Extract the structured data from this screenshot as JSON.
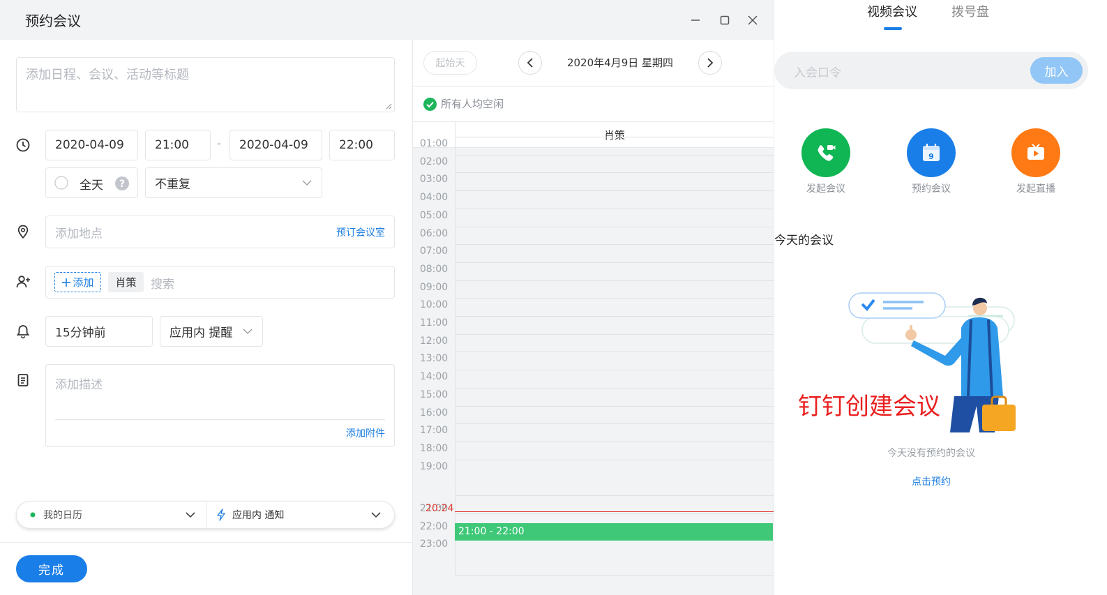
{
  "window": {
    "title": "预约会议"
  },
  "form": {
    "title_placeholder": "添加日程、会议、活动等标题",
    "start_date": "2020-04-09",
    "start_time": "21:00",
    "dash": "-",
    "end_date": "2020-04-09",
    "end_time": "22:00",
    "allday_label": "全天",
    "repeat": "不重复",
    "location_placeholder": "添加地点",
    "book_room": "预订会议室",
    "add_attendee": "添加",
    "attendee_chip": "肖策",
    "search_placeholder": "搜索",
    "remind_time": "15分钟前",
    "remind_type": "应用内 提醒",
    "desc_placeholder": "添加描述",
    "add_attachment": "添加附件",
    "calendar_select": "我的日历",
    "notify_select": "应用内 通知",
    "done_button": "完成"
  },
  "calendar": {
    "start_day_button": "起始天",
    "date_label": "2020年4月9日 星期四",
    "free_status": "所有人均空闲",
    "person_name": "肖策",
    "hours": [
      "01:00",
      "02:00",
      "03:00",
      "04:00",
      "05:00",
      "06:00",
      "07:00",
      "08:00",
      "09:00",
      "10:00",
      "11:00",
      "12:00",
      "13:00",
      "14:00",
      "15:00",
      "16:00",
      "17:00",
      "18:00",
      "19:00",
      "21:00",
      "22:00",
      "23:00"
    ],
    "now_label": "20:24",
    "event_label": "21:00 - 22:00"
  },
  "right_panel": {
    "tabs": [
      "视频会议",
      "拨号盘"
    ],
    "join_placeholder": "入会口令",
    "join_button": "加入",
    "apps": [
      {
        "label": "发起会议",
        "icon": "phone-video-icon",
        "color": "#0fb653"
      },
      {
        "label": "预约会议",
        "icon": "calendar-icon",
        "color": "#1a7ee8"
      },
      {
        "label": "发起直播",
        "icon": "tv-play-icon",
        "color": "#ff7a14"
      }
    ],
    "section_title": "今天的会议",
    "overlay_text": "钉钉创建会议",
    "empty_text": "今天没有预约的会议",
    "book_link": "点击预约"
  }
}
